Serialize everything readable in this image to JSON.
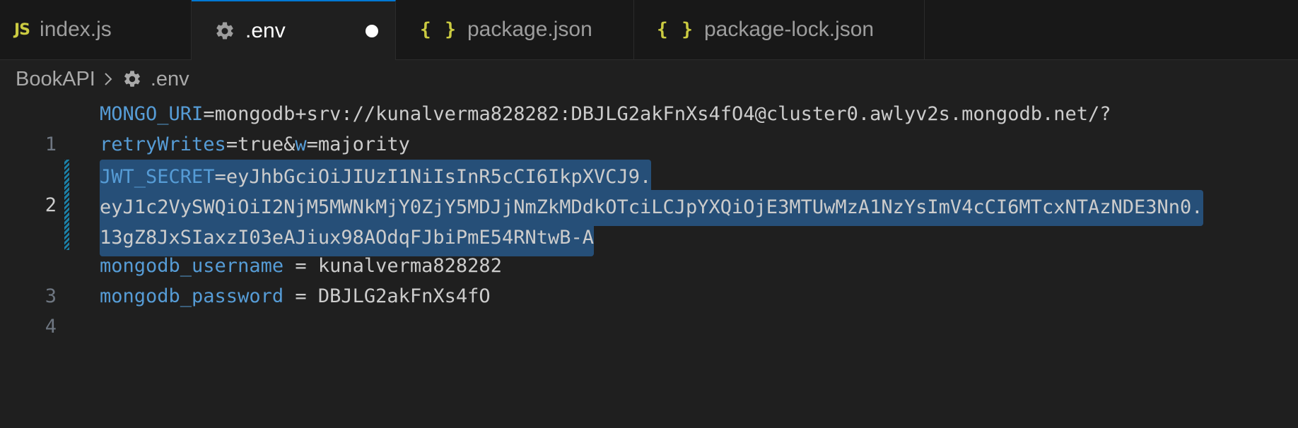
{
  "tabs": [
    {
      "label": "index.js",
      "icon": "js-icon",
      "icon_text": "JS",
      "active": false
    },
    {
      "label": ".env",
      "icon": "gear-icon",
      "active": true,
      "dirty": true
    },
    {
      "label": "package.json",
      "icon": "braces-icon",
      "icon_text": "{ }",
      "active": false
    },
    {
      "label": "package-lock.json",
      "icon": "braces-icon",
      "icon_text": "{ }",
      "active": false
    }
  ],
  "breadcrumb": {
    "folder": "BookAPI",
    "file": ".env"
  },
  "code": {
    "line1": {
      "number": "1",
      "key": "MONGO_URI",
      "value": "=mongodb+srv://kunalverma828282:DBJLG2akFnXs4fO4@cluster0.awlyv2s.mongodb.net/?",
      "wrap_key1": "retryWrites",
      "wrap_mid": "=true&",
      "wrap_key2": "w",
      "wrap_tail": "=majority"
    },
    "line2": {
      "number": "2",
      "key": "JWT_SECRET",
      "value": "=eyJhbGciOiJIUzI1NiIsInR5cCI6IkpXVCJ9.",
      "wrap1": "eyJ1c2VySWQiOiI2NjM5MWNkMjY0ZjY5MDJjNmZkMDdkOTciLCJpYXQiOjE3MTUwMzA1NzYsImV4cCI6MTcxNTAzNDE3Nn0.",
      "wrap2": "13gZ8JxSIaxzI03eAJiux98AOdqFJbiPmE54RNtwB-A"
    },
    "line3": {
      "number": "3",
      "key": "mongodb_username",
      "value": " = kunalverma828282"
    },
    "line4": {
      "number": "4",
      "key": "mongodb_password",
      "value": " = DBJLG2akFnXs4fO"
    }
  },
  "colors": {
    "accent": "#0078d4",
    "selection": "#264f78",
    "key": "#569cd6",
    "icon_yellow": "#cbcb41",
    "background": "#1f1f1f"
  }
}
